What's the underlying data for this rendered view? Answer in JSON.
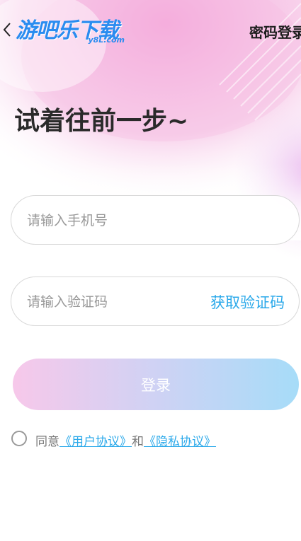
{
  "header": {
    "logo_text": "游吧乐下载",
    "logo_sub": "y8L.com",
    "password_login_label": "密码登录"
  },
  "main": {
    "headline": "试着往前一步~",
    "phone_placeholder": "请输入手机号",
    "code_placeholder": "请输入验证码",
    "get_code_label": "获取验证码",
    "login_label": "登录"
  },
  "agreement": {
    "prefix": "同意",
    "user_agreement": "《用户协议》",
    "and": "和",
    "privacy_agreement": "《隐私协议》",
    "checked": false
  },
  "colors": {
    "accent": "#2ba9ea",
    "logo": "#2a8cf0",
    "gradient_start": "#f7c8ea",
    "gradient_end": "#a6dcf8"
  },
  "icons": {
    "back": "chevron-left-icon",
    "radio": "radio-unchecked-icon"
  }
}
